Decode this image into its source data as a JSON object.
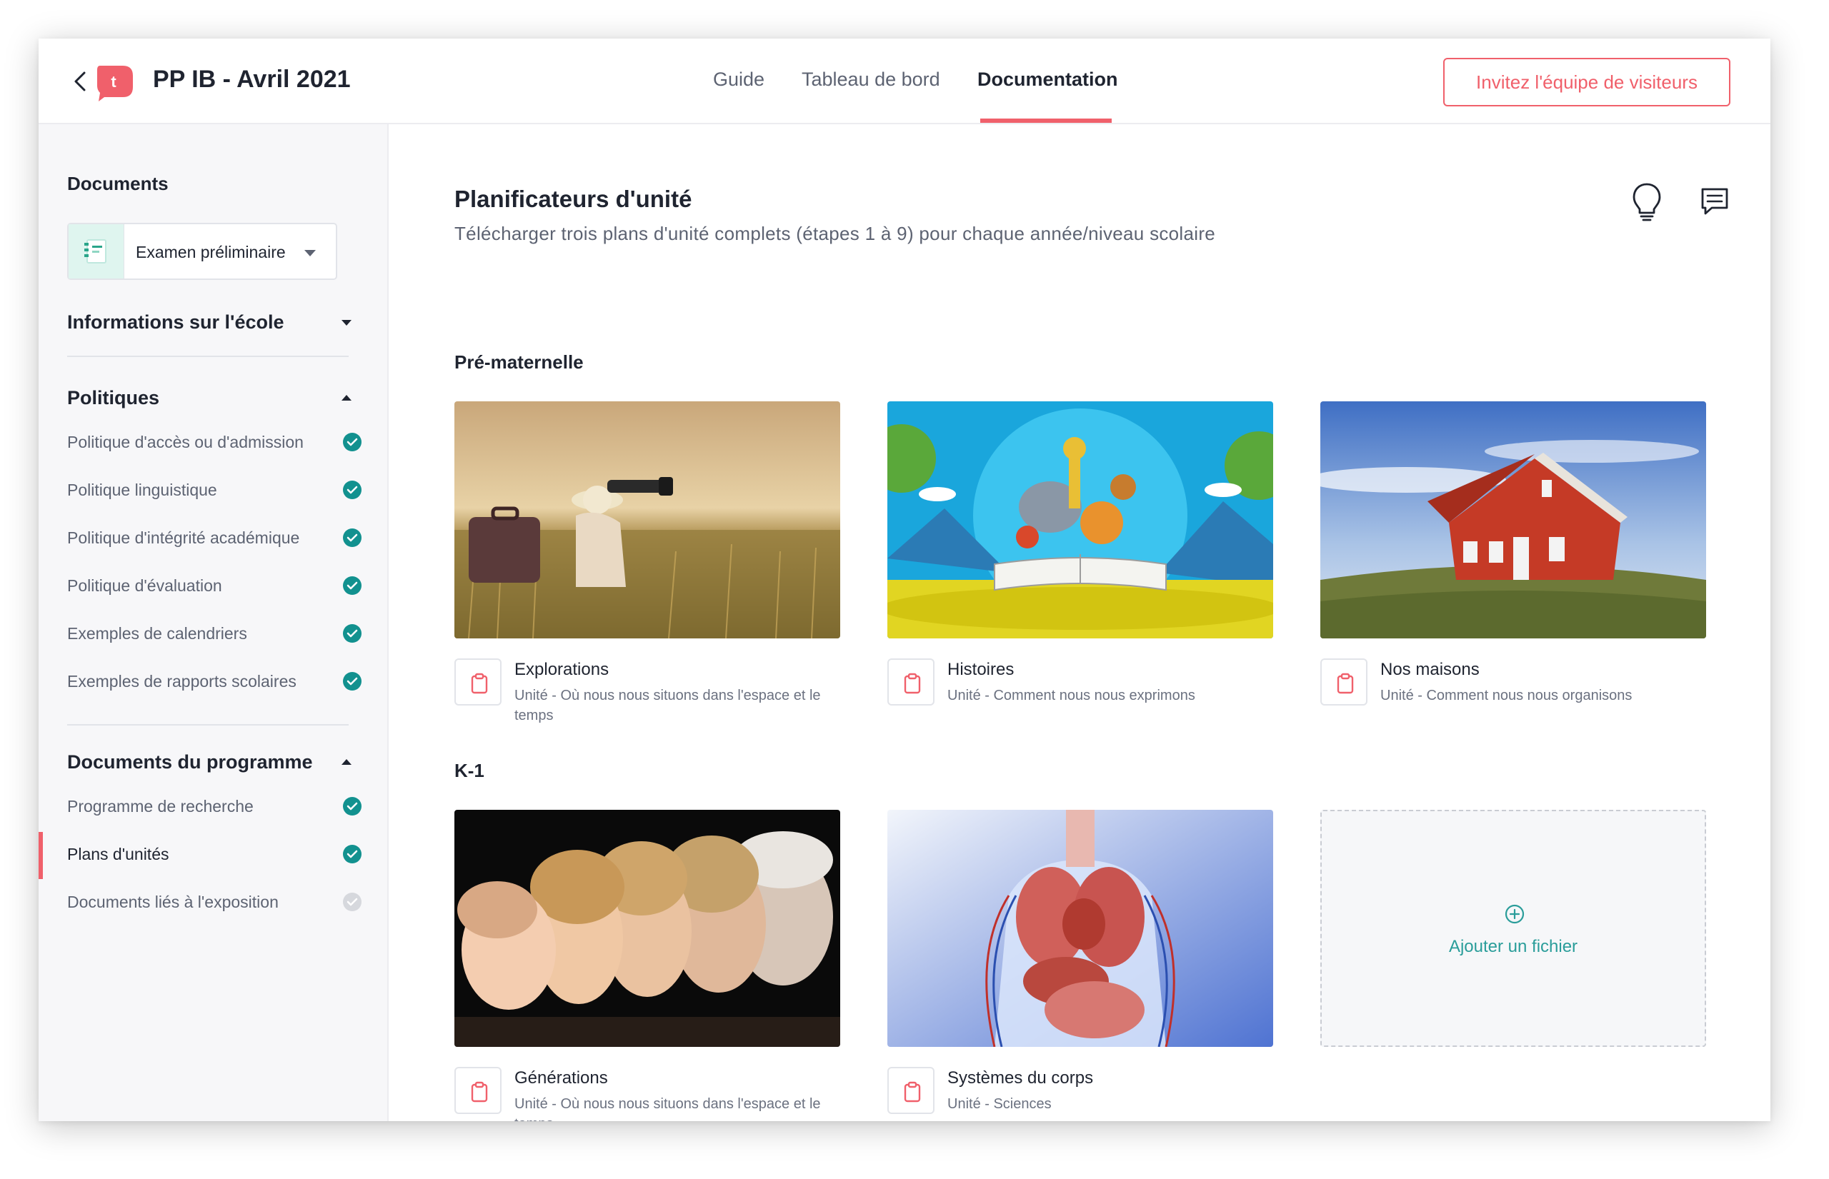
{
  "header": {
    "title": "PP IB - Avril 2021",
    "logo_letter": "t",
    "tabs": [
      {
        "label": "Guide",
        "active": false
      },
      {
        "label": "Tableau de bord",
        "active": false
      },
      {
        "label": "Documentation",
        "active": true
      }
    ],
    "invite_label": "Invitez l'équipe de visiteurs"
  },
  "sidebar": {
    "documents_heading": "Documents",
    "selector_value": "Examen préliminaire",
    "school_info_label": "Informations sur l'école",
    "policies": {
      "label": "Politiques",
      "items": [
        {
          "label": "Politique d'accès ou d'admission",
          "done": true
        },
        {
          "label": "Politique linguistique",
          "done": true
        },
        {
          "label": "Politique d'intégrité académique",
          "done": true
        },
        {
          "label": "Politique d'évaluation",
          "done": true
        },
        {
          "label": "Exemples de calendriers",
          "done": true
        },
        {
          "label": "Exemples de rapports scolaires",
          "done": true
        }
      ]
    },
    "program_docs": {
      "label": "Documents du programme",
      "items": [
        {
          "label": "Programme de recherche",
          "done": true
        },
        {
          "label": "Plans d'unités",
          "done": true,
          "active": true
        },
        {
          "label": "Documents liés à l'exposition",
          "done": false
        }
      ]
    }
  },
  "main": {
    "title": "Planificateurs d'unité",
    "subtitle": "Télécharger trois plans d'unité complets (étapes 1 à 9) pour chaque année/niveau scolaire",
    "sections": [
      {
        "title": "Pré-maternelle",
        "cards": [
          {
            "title": "Explorations",
            "subtitle": "Unité - Où nous nous situons dans l'espace et le temps"
          },
          {
            "title": "Histoires",
            "subtitle": "Unité - Comment nous nous exprimons"
          },
          {
            "title": "Nos maisons",
            "subtitle": "Unité - Comment nous nous organisons"
          }
        ]
      },
      {
        "title": "K-1",
        "cards": [
          {
            "title": "Générations",
            "subtitle": "Unité - Où nous nous situons dans l'espace et le temps"
          },
          {
            "title": "Systèmes du corps",
            "subtitle": "Unité - Sciences"
          }
        ],
        "add_file_label": "Ajouter un fichier"
      }
    ]
  },
  "colors": {
    "accent": "#f0606b",
    "teal": "#12918f",
    "text": "#1f2430",
    "muted": "#5d6372"
  }
}
